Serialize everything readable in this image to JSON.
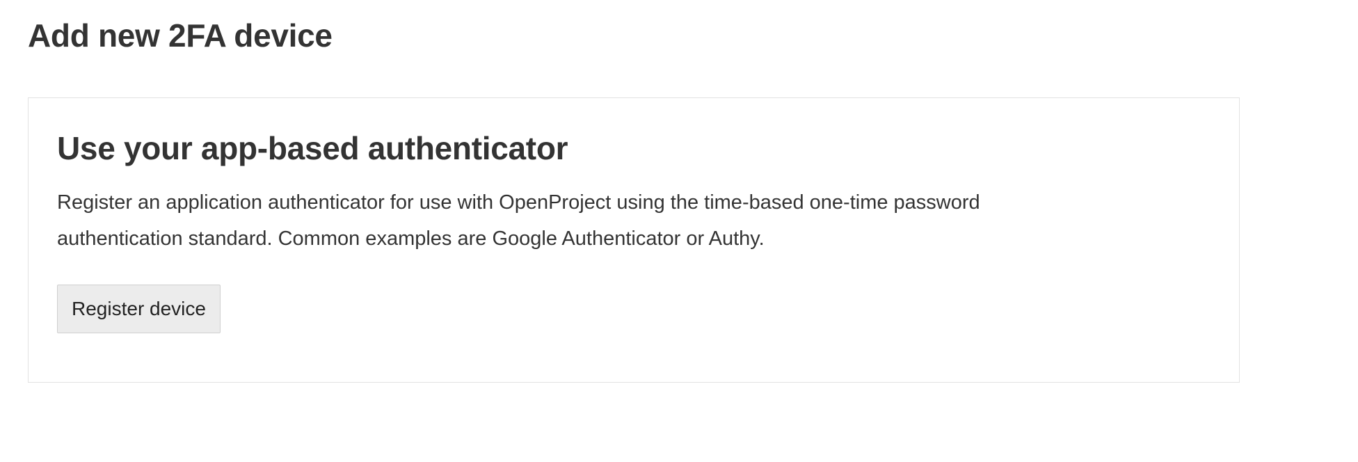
{
  "page": {
    "title": "Add new 2FA device"
  },
  "card": {
    "title": "Use your app-based authenticator",
    "description_lines": [
      "Register an application authenticator for use with OpenProject using the time-based one-time password",
      "authentication standard. Common examples are Google Authenticator or Authy."
    ],
    "button_label": "Register device"
  }
}
